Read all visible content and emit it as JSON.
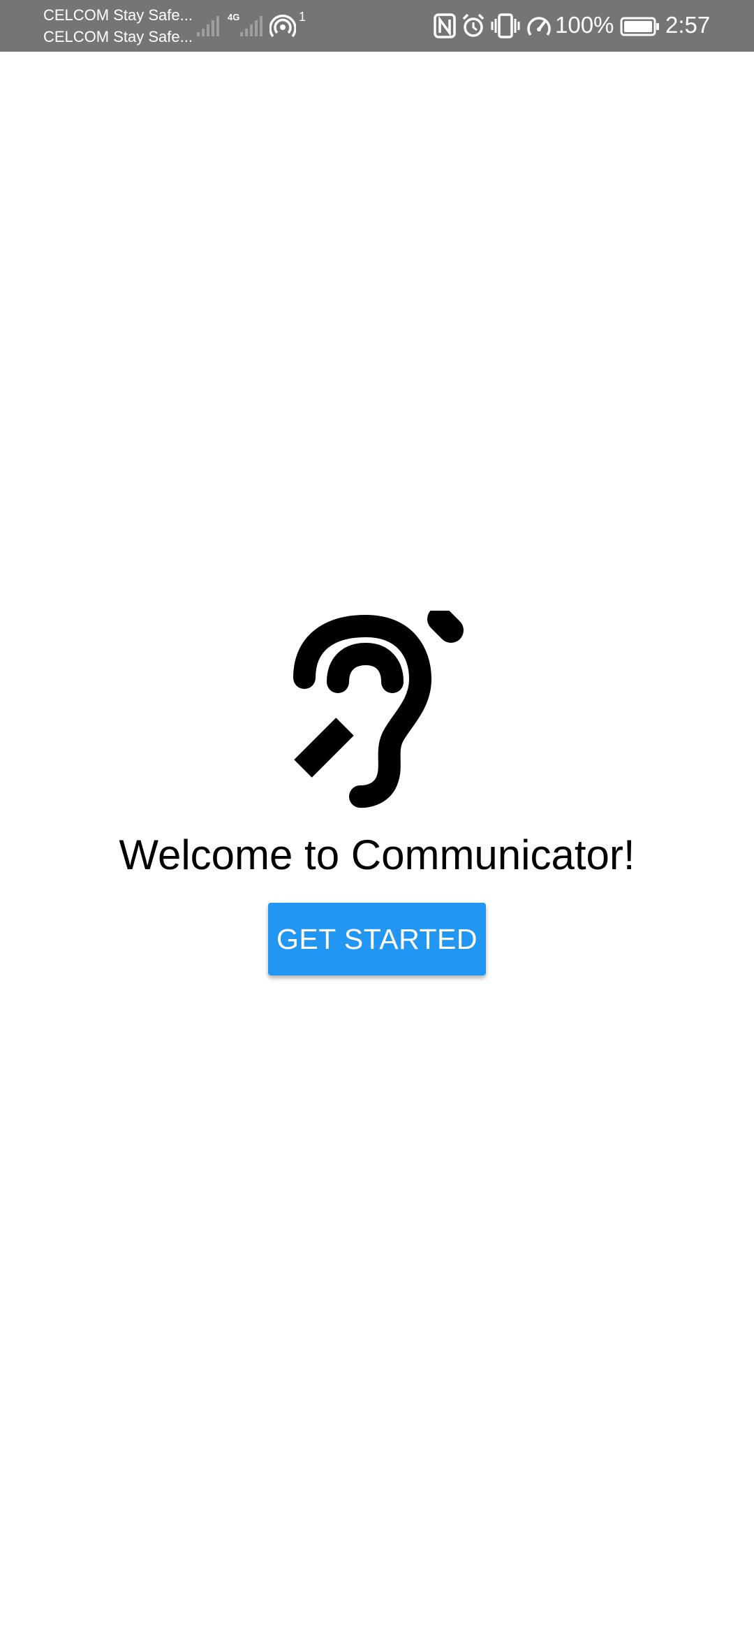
{
  "status_bar": {
    "carrier_1": "CELCOM Stay Safe...",
    "carrier_2": "CELCOM Stay Safe...",
    "network_type": "4G",
    "hotspot_count": "1",
    "battery_percent": "100%",
    "time": "2:57",
    "icons": [
      "signal-icon",
      "signal-icon",
      "hotspot-icon",
      "nfc-icon",
      "alarm-icon",
      "vibrate-icon",
      "data-saver-icon",
      "battery-icon"
    ],
    "background_color": "#757575"
  },
  "main": {
    "logo_icon": "hearing-impaired-ear-icon",
    "welcome_text": "Welcome to Communicator!",
    "get_started_label": "GET STARTED",
    "accent_color": "#2196f3"
  }
}
